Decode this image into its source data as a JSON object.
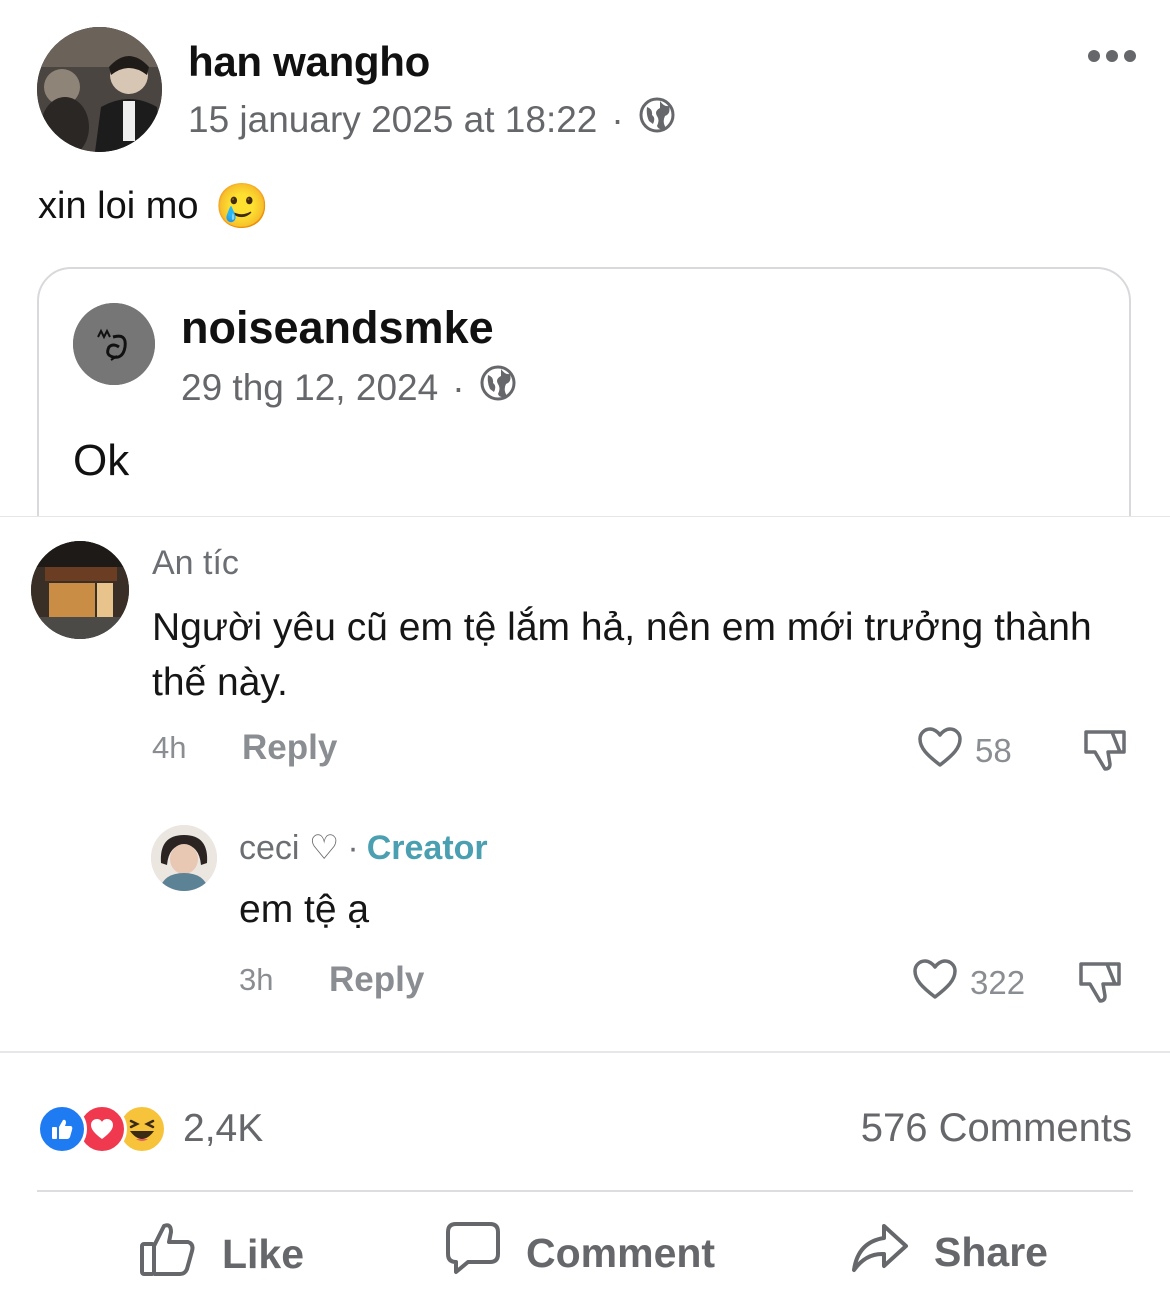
{
  "post": {
    "author": "han wangho",
    "timestamp": "15 january 2025 at 18:22",
    "separator": "·",
    "privacy_icon": "globe-icon",
    "text": "xin loi mo",
    "emoji": "🥲"
  },
  "shared_post": {
    "author": "noiseandsmke",
    "timestamp": "29 thg 12, 2024",
    "separator": "·",
    "privacy_icon": "globe-icon",
    "text": "Ok"
  },
  "comments": [
    {
      "author": "An tíc",
      "text": "Người yêu cũ em tệ lắm hả, nên em mới trưởng thành thế này.",
      "time": "4h",
      "reply_label": "Reply",
      "likes": "58"
    },
    {
      "author": "ceci ♡",
      "separator": "·",
      "badge": "Creator",
      "text": "em tệ ạ",
      "time": "3h",
      "reply_label": "Reply",
      "likes": "322"
    }
  ],
  "reactions": {
    "count": "2,4K",
    "types": [
      "like",
      "love",
      "haha"
    ]
  },
  "comments_count": "576 Comments",
  "actions": {
    "like": "Like",
    "comment": "Comment",
    "share": "Share"
  },
  "colors": {
    "text": "#111111",
    "muted": "#65676b",
    "creator_accent": "#4a9fb1",
    "like_blue": "#1f7bf2",
    "love_red": "#f0384f",
    "haha_yellow": "#f7c33a"
  }
}
